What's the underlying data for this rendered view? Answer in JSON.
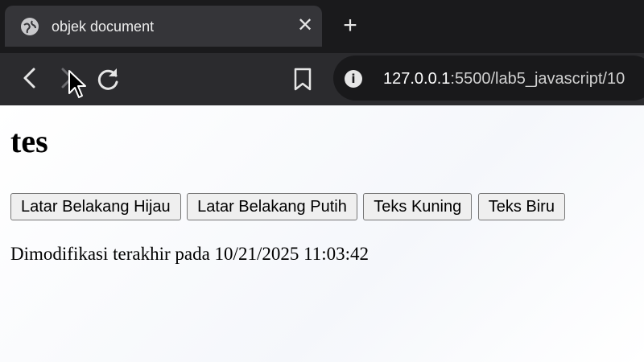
{
  "browser": {
    "tab": {
      "title": "objek document",
      "close": "✕"
    },
    "new_tab": "+",
    "address": {
      "host": "127.0.0.1",
      "rest": ":5500/lab5_javascript/10"
    }
  },
  "page": {
    "heading": "tes",
    "buttons": [
      {
        "label": "Latar Belakang Hijau"
      },
      {
        "label": "Latar Belakang Putih"
      },
      {
        "label": "Teks Kuning"
      },
      {
        "label": "Teks Biru"
      }
    ],
    "modified_text": "Dimodifikasi terakhir pada 10/21/2025 11:03:42"
  }
}
